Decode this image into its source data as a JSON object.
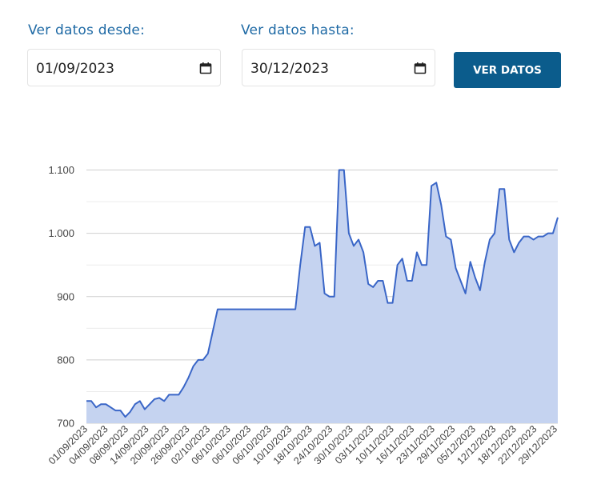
{
  "filters": {
    "from_label": "Ver datos desde:",
    "from_value": "01/09/2023",
    "to_label": "Ver datos hasta:",
    "to_value": "30/12/2023",
    "button_label": "VER DATOS"
  },
  "colors": {
    "label": "#1f6aa5",
    "button": "#0b5c8c",
    "line": "#3a66c7",
    "fill": "#c5d3f0",
    "grid": "#cfcfcf"
  },
  "chart_data": {
    "type": "area",
    "ylim": [
      700,
      1100
    ],
    "yticks": [
      700,
      800,
      900,
      1000,
      1100
    ],
    "ytick_labels": [
      "700",
      "800",
      "900",
      "1.000",
      "1.100"
    ],
    "xtick_labels": [
      "01/09/2023",
      "04/09/2023",
      "08/09/2023",
      "14/09/2023",
      "20/09/2023",
      "26/09/2023",
      "02/10/2023",
      "06/10/2023",
      "06/10/2023",
      "06/10/2023",
      "10/10/2023",
      "18/10/2023",
      "24/10/2023",
      "30/10/2023",
      "03/11/2023",
      "10/11/2023",
      "16/11/2023",
      "23/11/2023",
      "29/11/2023",
      "05/12/2023",
      "12/12/2023",
      "18/12/2023",
      "22/12/2023",
      "29/12/2023"
    ],
    "grid": true,
    "values": [
      735,
      735,
      725,
      730,
      730,
      725,
      720,
      720,
      710,
      718,
      730,
      735,
      722,
      730,
      738,
      740,
      735,
      745,
      745,
      745,
      757,
      772,
      790,
      800,
      800,
      810,
      845,
      880,
      880,
      880,
      880,
      880,
      880,
      880,
      880,
      880,
      880,
      880,
      880,
      880,
      880,
      880,
      880,
      880,
      950,
      1010,
      1010,
      980,
      985,
      905,
      900,
      900,
      1100,
      1100,
      1000,
      980,
      990,
      970,
      920,
      915,
      925,
      925,
      890,
      890,
      950,
      960,
      925,
      925,
      970,
      950,
      950,
      1075,
      1080,
      1045,
      995,
      990,
      945,
      925,
      905,
      955,
      930,
      910,
      955,
      990,
      1000,
      1070,
      1070,
      990,
      970,
      985,
      995,
      995,
      990,
      995,
      995,
      1000,
      1000,
      1025
    ]
  }
}
